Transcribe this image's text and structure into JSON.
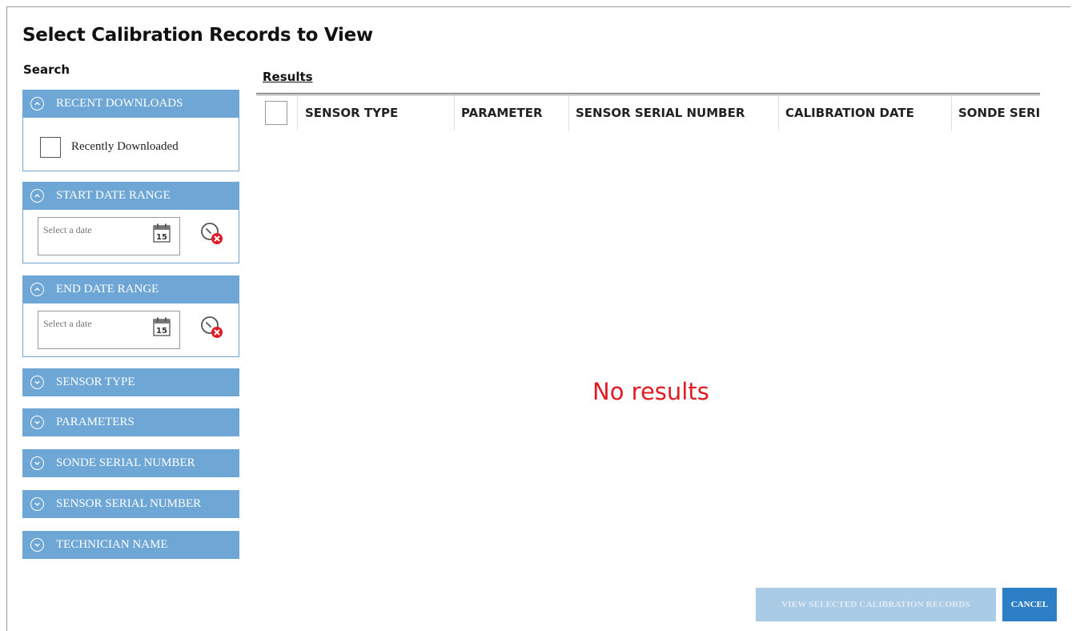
{
  "dialog": {
    "title": "Select Calibration Records to View"
  },
  "search": {
    "label": "Search",
    "recent_downloads": {
      "header": "RECENT DOWNLOADS",
      "checkbox_label": "Recently Downloaded",
      "checked": false
    },
    "start_date_range": {
      "header": "START DATE RANGE",
      "placeholder": "Select a date",
      "calendar_day": "15"
    },
    "end_date_range": {
      "header": "END DATE RANGE",
      "placeholder": "Select a date",
      "calendar_day": "15"
    },
    "collapsed_panels": [
      {
        "header": "SENSOR TYPE"
      },
      {
        "header": "PARAMETERS"
      },
      {
        "header": "SONDE SERIAL NUMBER"
      },
      {
        "header": "SENSOR SERIAL NUMBER"
      },
      {
        "header": "TECHNICIAN NAME"
      }
    ]
  },
  "results": {
    "label": "Results",
    "columns": [
      "SENSOR TYPE",
      "PARAMETER",
      "SENSOR SERIAL NUMBER",
      "CALIBRATION DATE",
      "SONDE SERIA"
    ],
    "empty_message": "No results"
  },
  "buttons": {
    "view_selected": "VIEW SELECTED CALIBRATION RECORDS",
    "cancel": "CANCEL"
  },
  "colors": {
    "panel_header": "#6ea7d5",
    "no_results_text": "#e01b24",
    "cancel_button": "#2d7fc5",
    "view_button_disabled": "#a9cbe6"
  },
  "icons": {
    "expanded_chevron": "chevron-up-icon",
    "collapsed_chevron": "chevron-down-icon",
    "calendar": "calendar-icon",
    "clear_date": "clear-date-icon"
  }
}
